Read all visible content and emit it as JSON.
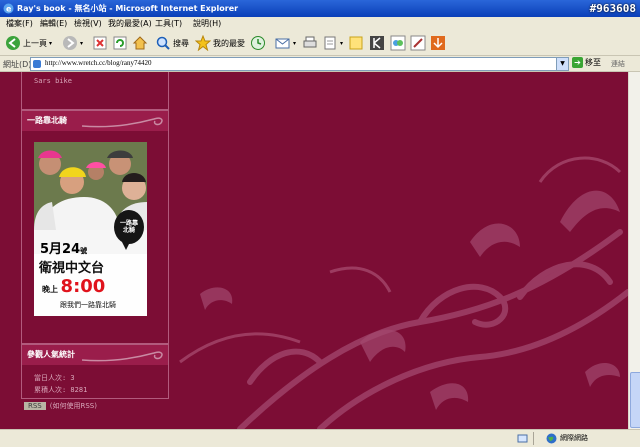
{
  "window": {
    "title": "Ray's book - 無名小站 - Microsoft Internet Explorer",
    "tag": "#963608"
  },
  "menu": [
    "檔案(F)",
    "編輯(E)",
    "檢視(V)",
    "我的最愛(A)",
    "工具(T)",
    "說明(H)"
  ],
  "toolbar": {
    "back": "上一頁",
    "search": "搜尋",
    "favorites": "我的最愛"
  },
  "address": {
    "label": "網址(D)",
    "url": "http://www.wretch.cc/blog/rany74420",
    "go": "移至",
    "links": "連結"
  },
  "sidebar": {
    "top_item": "Sars bike",
    "ride": {
      "title": "一路靠北騎",
      "ad": {
        "logo": "一路靠北騎",
        "date_num": "5月24",
        "date_suffix": "號",
        "channel": "衛視中文台",
        "time_prefix": "晚上",
        "time": "8:00",
        "tagline": "跟我們一路靠北騎"
      }
    },
    "visitors": {
      "title": "參觀人氣統計",
      "today": "當日人次: 3",
      "total": "累積人次: 8281"
    },
    "rss": {
      "badge": "RSS",
      "note": "(如何使用RSS)"
    }
  },
  "status": {
    "zone": "網際網路"
  }
}
